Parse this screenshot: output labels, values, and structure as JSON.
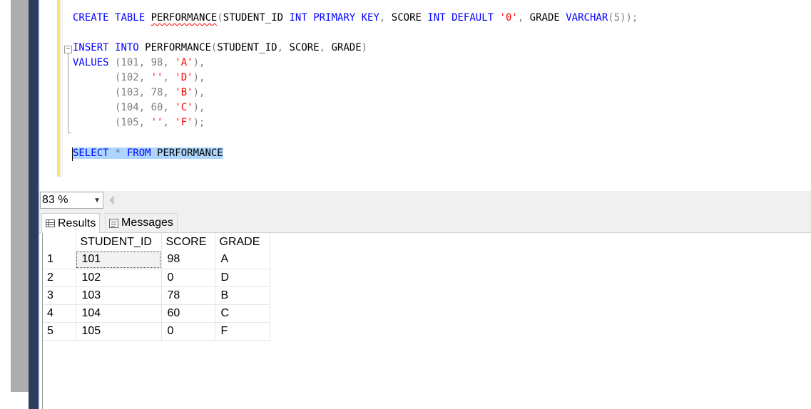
{
  "editor": {
    "lines": [
      {
        "parts": [
          {
            "t": "CREATE",
            "c": "kw"
          },
          {
            "t": " ",
            "c": "blk"
          },
          {
            "t": "TABLE",
            "c": "kw"
          },
          {
            "t": " ",
            "c": "blk"
          },
          {
            "t": "PERFORMANCE",
            "c": "blk squiggle"
          },
          {
            "t": "(",
            "c": "gr"
          },
          {
            "t": "STUDENT_ID ",
            "c": "blk"
          },
          {
            "t": "INT PRIMARY KEY",
            "c": "kw"
          },
          {
            "t": ", ",
            "c": "gr"
          },
          {
            "t": "SCORE ",
            "c": "blk"
          },
          {
            "t": "INT DEFAULT",
            "c": "kw"
          },
          {
            "t": " ",
            "c": "blk"
          },
          {
            "t": "'0'",
            "c": "str"
          },
          {
            "t": ", ",
            "c": "gr"
          },
          {
            "t": "GRADE ",
            "c": "blk"
          },
          {
            "t": "VARCHAR",
            "c": "kw"
          },
          {
            "t": "(5));",
            "c": "gr"
          }
        ]
      },
      {
        "parts": [
          {
            "t": "INSERT",
            "c": "kw"
          },
          {
            "t": " ",
            "c": "blk"
          },
          {
            "t": "INTO",
            "c": "kw"
          },
          {
            "t": " PERFORMANCE",
            "c": "blk"
          },
          {
            "t": "(",
            "c": "gr"
          },
          {
            "t": "STUDENT_ID",
            "c": "blk"
          },
          {
            "t": ", ",
            "c": "gr"
          },
          {
            "t": "SCORE",
            "c": "blk"
          },
          {
            "t": ", ",
            "c": "gr"
          },
          {
            "t": "GRADE",
            "c": "blk"
          },
          {
            "t": ")",
            "c": "gr"
          }
        ]
      },
      {
        "parts": [
          {
            "t": "VALUES",
            "c": "kw"
          },
          {
            "t": " (101, 98, ",
            "c": "gr"
          },
          {
            "t": "'A'",
            "c": "str"
          },
          {
            "t": "),",
            "c": "gr"
          }
        ]
      },
      {
        "parts": [
          {
            "t": "       (102, ",
            "c": "gr"
          },
          {
            "t": "''",
            "c": "str"
          },
          {
            "t": ", ",
            "c": "gr"
          },
          {
            "t": "'D'",
            "c": "str"
          },
          {
            "t": "),",
            "c": "gr"
          }
        ]
      },
      {
        "parts": [
          {
            "t": "       (103, 78, ",
            "c": "gr"
          },
          {
            "t": "'B'",
            "c": "str"
          },
          {
            "t": "),",
            "c": "gr"
          }
        ]
      },
      {
        "parts": [
          {
            "t": "       (104, 60, ",
            "c": "gr"
          },
          {
            "t": "'C'",
            "c": "str"
          },
          {
            "t": "),",
            "c": "gr"
          }
        ]
      },
      {
        "parts": [
          {
            "t": "       (105, ",
            "c": "gr"
          },
          {
            "t": "''",
            "c": "str"
          },
          {
            "t": ", ",
            "c": "gr"
          },
          {
            "t": "'F'",
            "c": "str"
          },
          {
            "t": ");",
            "c": "gr"
          }
        ]
      },
      {
        "parts": [
          {
            "t": "SELECT",
            "c": "kw sel"
          },
          {
            "t": " * ",
            "c": "gr sel"
          },
          {
            "t": "FROM",
            "c": "kw sel"
          },
          {
            "t": " PERFORMANCE",
            "c": "blk sel"
          }
        ]
      }
    ]
  },
  "zoom": {
    "value": "83 %"
  },
  "tabs": {
    "results": "Results",
    "messages": "Messages"
  },
  "grid": {
    "columns": [
      "STUDENT_ID",
      "SCORE",
      "GRADE"
    ],
    "rows": [
      {
        "n": "1",
        "cells": [
          "101",
          "98",
          "A"
        ]
      },
      {
        "n": "2",
        "cells": [
          "102",
          "0",
          "D"
        ]
      },
      {
        "n": "3",
        "cells": [
          "103",
          "78",
          "B"
        ]
      },
      {
        "n": "4",
        "cells": [
          "104",
          "60",
          "C"
        ]
      },
      {
        "n": "5",
        "cells": [
          "105",
          "0",
          "F"
        ]
      }
    ]
  }
}
